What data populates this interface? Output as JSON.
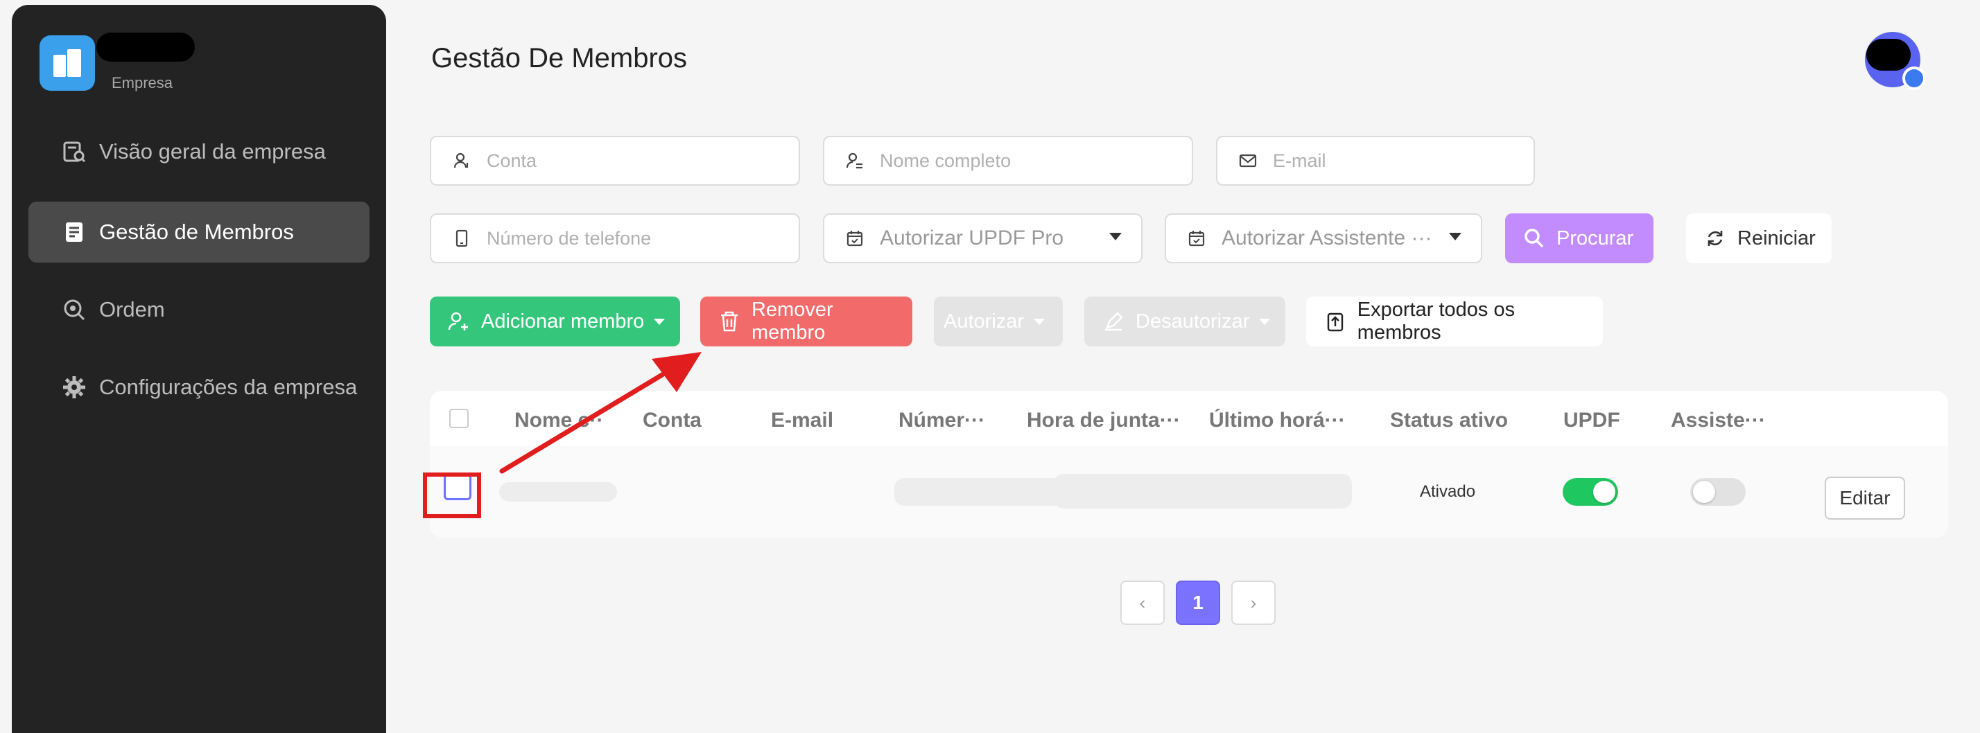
{
  "sidebar": {
    "logo_subtitle": "Empresa",
    "items": [
      {
        "label": "Visão geral da empresa",
        "icon": "report-search-icon"
      },
      {
        "label": "Gestão de Membros",
        "icon": "member-list-icon",
        "active": true
      },
      {
        "label": "Ordem",
        "icon": "order-icon"
      },
      {
        "label": "Configurações da empresa",
        "icon": "gear-icon"
      }
    ]
  },
  "header": {
    "title": "Gestão De Membros"
  },
  "filters": {
    "account_placeholder": "Conta",
    "fullname_placeholder": "Nome completo",
    "email_placeholder": "E-mail",
    "phone_placeholder": "Número de telefone",
    "authorize_pro": "Autorizar UPDF Pro",
    "authorize_assistant": "Autorizar Assistente ···",
    "search_label": "Procurar",
    "reset_label": "Reiniciar"
  },
  "actions": {
    "add_member": "Adicionar membro",
    "remove_member": "Remover membro",
    "authorize": "Autorizar",
    "deauthorize": "Desautorizar",
    "export_all": "Exportar todos os membros"
  },
  "table": {
    "columns": [
      "Nome c···",
      "Conta",
      "E-mail",
      "Númer···",
      "Hora de junta···",
      "Último horá···",
      "Status ativo",
      "UPDF",
      "Assiste···"
    ],
    "rows": [
      {
        "status": "Ativado",
        "updf_enabled": true,
        "assistant_enabled": false,
        "edit_label": "Editar"
      }
    ]
  },
  "pagination": {
    "prev": "‹",
    "current": "1",
    "next": "›"
  },
  "colors": {
    "accent_purple": "#7b73ff",
    "add_green": "#34c77b",
    "remove_red": "#f26a6a",
    "search_purple": "#c28cff",
    "sidebar_bg": "#232323",
    "annotation_red": "#e11d1d"
  }
}
